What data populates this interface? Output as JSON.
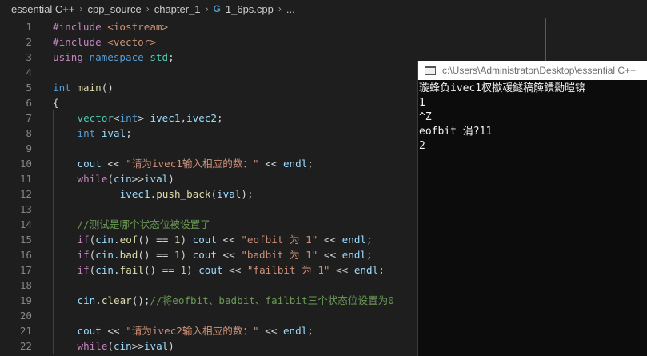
{
  "breadcrumb": {
    "items": [
      "essential C++",
      "cpp_source",
      "chapter_1"
    ],
    "file_icon": "G",
    "file": "1_6ps.cpp",
    "more": "..."
  },
  "editor": {
    "lines": [
      {
        "n": "1",
        "indent": 0,
        "tokens": [
          {
            "t": "#include",
            "c": "pp"
          },
          {
            "t": " <iostream>",
            "c": "inc"
          }
        ]
      },
      {
        "n": "2",
        "indent": 0,
        "tokens": [
          {
            "t": "#include",
            "c": "pp"
          },
          {
            "t": " <vector>",
            "c": "inc"
          }
        ]
      },
      {
        "n": "3",
        "indent": 0,
        "tokens": [
          {
            "t": "using",
            "c": "ctl"
          },
          {
            "t": " ",
            "c": "op"
          },
          {
            "t": "namespace",
            "c": "kw"
          },
          {
            "t": " ",
            "c": "op"
          },
          {
            "t": "std",
            "c": "ty"
          },
          {
            "t": ";",
            "c": "op"
          }
        ]
      },
      {
        "n": "4",
        "indent": 0,
        "tokens": []
      },
      {
        "n": "5",
        "indent": 0,
        "tokens": [
          {
            "t": "int",
            "c": "kw"
          },
          {
            "t": " ",
            "c": "op"
          },
          {
            "t": "main",
            "c": "fn"
          },
          {
            "t": "()",
            "c": "op"
          }
        ]
      },
      {
        "n": "6",
        "indent": 0,
        "tokens": [
          {
            "t": "{",
            "c": "op"
          }
        ]
      },
      {
        "n": "7",
        "indent": 1,
        "tokens": [
          {
            "t": "vector",
            "c": "ty"
          },
          {
            "t": "<",
            "c": "op"
          },
          {
            "t": "int",
            "c": "kw"
          },
          {
            "t": "> ",
            "c": "op"
          },
          {
            "t": "ivec1",
            "c": "var"
          },
          {
            "t": ",",
            "c": "op"
          },
          {
            "t": "ivec2",
            "c": "var"
          },
          {
            "t": ";",
            "c": "op"
          }
        ]
      },
      {
        "n": "8",
        "indent": 1,
        "tokens": [
          {
            "t": "int",
            "c": "kw"
          },
          {
            "t": " ",
            "c": "op"
          },
          {
            "t": "ival",
            "c": "var"
          },
          {
            "t": ";",
            "c": "op"
          }
        ]
      },
      {
        "n": "9",
        "indent": 1,
        "tokens": []
      },
      {
        "n": "10",
        "indent": 1,
        "tokens": [
          {
            "t": "cout",
            "c": "var"
          },
          {
            "t": " << ",
            "c": "op"
          },
          {
            "t": "\"请为ivec1输入相应的数：\"",
            "c": "str"
          },
          {
            "t": " << ",
            "c": "op"
          },
          {
            "t": "endl",
            "c": "var"
          },
          {
            "t": ";",
            "c": "op"
          }
        ]
      },
      {
        "n": "11",
        "indent": 1,
        "tokens": [
          {
            "t": "while",
            "c": "ctl"
          },
          {
            "t": "(",
            "c": "op"
          },
          {
            "t": "cin",
            "c": "var"
          },
          {
            "t": ">>",
            "c": "op"
          },
          {
            "t": "ival",
            "c": "var"
          },
          {
            "t": ")",
            "c": "op"
          }
        ]
      },
      {
        "n": "12",
        "indent": 1,
        "extra": "       ",
        "tokens": [
          {
            "t": "ivec1",
            "c": "var"
          },
          {
            "t": ".",
            "c": "op"
          },
          {
            "t": "push_back",
            "c": "fn"
          },
          {
            "t": "(",
            "c": "op"
          },
          {
            "t": "ival",
            "c": "var"
          },
          {
            "t": ");",
            "c": "op"
          }
        ]
      },
      {
        "n": "13",
        "indent": 1,
        "tokens": []
      },
      {
        "n": "14",
        "indent": 1,
        "tokens": [
          {
            "t": "//测试是哪个状态位被设置了",
            "c": "cmt"
          }
        ]
      },
      {
        "n": "15",
        "indent": 1,
        "tokens": [
          {
            "t": "if",
            "c": "ctl"
          },
          {
            "t": "(",
            "c": "op"
          },
          {
            "t": "cin",
            "c": "var"
          },
          {
            "t": ".",
            "c": "op"
          },
          {
            "t": "eof",
            "c": "fn"
          },
          {
            "t": "() == ",
            "c": "op"
          },
          {
            "t": "1",
            "c": "num"
          },
          {
            "t": ") ",
            "c": "op"
          },
          {
            "t": "cout",
            "c": "var"
          },
          {
            "t": " << ",
            "c": "op"
          },
          {
            "t": "\"eofbit 为 1\"",
            "c": "str"
          },
          {
            "t": " << ",
            "c": "op"
          },
          {
            "t": "endl",
            "c": "var"
          },
          {
            "t": ";",
            "c": "op"
          }
        ]
      },
      {
        "n": "16",
        "indent": 1,
        "tokens": [
          {
            "t": "if",
            "c": "ctl"
          },
          {
            "t": "(",
            "c": "op"
          },
          {
            "t": "cin",
            "c": "var"
          },
          {
            "t": ".",
            "c": "op"
          },
          {
            "t": "bad",
            "c": "fn"
          },
          {
            "t": "() == ",
            "c": "op"
          },
          {
            "t": "1",
            "c": "num"
          },
          {
            "t": ") ",
            "c": "op"
          },
          {
            "t": "cout",
            "c": "var"
          },
          {
            "t": " << ",
            "c": "op"
          },
          {
            "t": "\"badbit 为 1\"",
            "c": "str"
          },
          {
            "t": " << ",
            "c": "op"
          },
          {
            "t": "endl",
            "c": "var"
          },
          {
            "t": ";",
            "c": "op"
          }
        ]
      },
      {
        "n": "17",
        "indent": 1,
        "tokens": [
          {
            "t": "if",
            "c": "ctl"
          },
          {
            "t": "(",
            "c": "op"
          },
          {
            "t": "cin",
            "c": "var"
          },
          {
            "t": ".",
            "c": "op"
          },
          {
            "t": "fail",
            "c": "fn"
          },
          {
            "t": "() == ",
            "c": "op"
          },
          {
            "t": "1",
            "c": "num"
          },
          {
            "t": ") ",
            "c": "op"
          },
          {
            "t": "cout",
            "c": "var"
          },
          {
            "t": " << ",
            "c": "op"
          },
          {
            "t": "\"failbit 为 1\"",
            "c": "str"
          },
          {
            "t": " << ",
            "c": "op"
          },
          {
            "t": "endl",
            "c": "var"
          },
          {
            "t": ";",
            "c": "op"
          }
        ]
      },
      {
        "n": "18",
        "indent": 1,
        "tokens": []
      },
      {
        "n": "19",
        "indent": 1,
        "tokens": [
          {
            "t": "cin",
            "c": "var"
          },
          {
            "t": ".",
            "c": "op"
          },
          {
            "t": "clear",
            "c": "fn"
          },
          {
            "t": "();",
            "c": "op"
          },
          {
            "t": "//将eofbit、badbit、failbit三个状态位设置为0",
            "c": "cmt"
          }
        ]
      },
      {
        "n": "20",
        "indent": 1,
        "tokens": []
      },
      {
        "n": "21",
        "indent": 1,
        "tokens": [
          {
            "t": "cout",
            "c": "var"
          },
          {
            "t": " << ",
            "c": "op"
          },
          {
            "t": "\"请为ivec2输入相应的数：\"",
            "c": "str"
          },
          {
            "t": " << ",
            "c": "op"
          },
          {
            "t": "endl",
            "c": "var"
          },
          {
            "t": ";",
            "c": "op"
          }
        ]
      },
      {
        "n": "22",
        "indent": 1,
        "tokens": [
          {
            "t": "while",
            "c": "ctl"
          },
          {
            "t": "(",
            "c": "op"
          },
          {
            "t": "cin",
            "c": "var"
          },
          {
            "t": ">>",
            "c": "op"
          },
          {
            "t": "ival",
            "c": "var"
          },
          {
            "t": ")",
            "c": "op"
          }
        ]
      }
    ]
  },
  "console": {
    "title": "c:\\Users\\Administrator\\Desktop\\essential C++",
    "lines": [
      "璇蜂负ivec1杈撳叆鐩稿簲鐨勬暟锛",
      "1",
      "^Z",
      "eofbit 涓?11",
      "2"
    ]
  },
  "colors": {
    "editor_bg": "#1e1e1e",
    "console_bg": "#0c0c0c",
    "keyword": "#569cd6",
    "control": "#c586c0",
    "type": "#4ec9b0",
    "function": "#dcdcaa",
    "variable": "#9cdcfe",
    "string": "#ce9178",
    "number": "#b5cea8",
    "comment": "#6a9955"
  }
}
